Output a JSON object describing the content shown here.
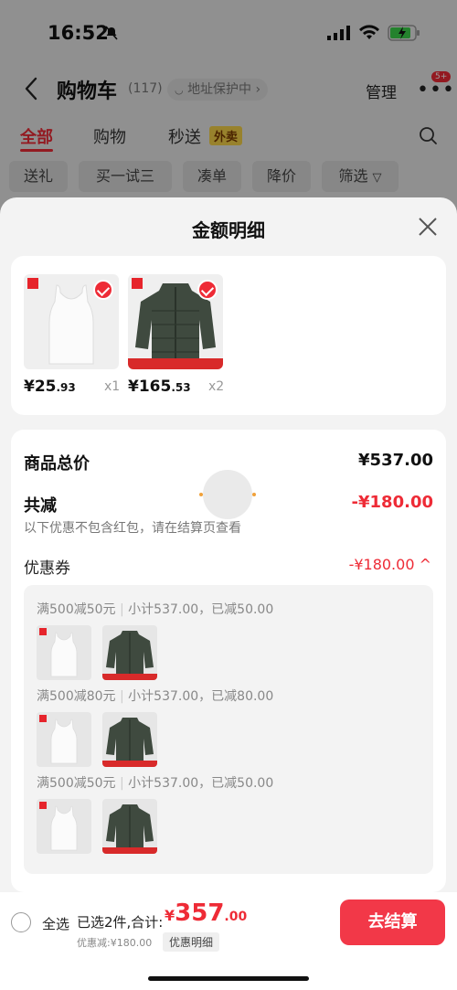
{
  "status_bar": {
    "time": "16:52"
  },
  "header": {
    "title": "购物车",
    "count": "(117)",
    "address_badge": "地址保护中",
    "manage": "管理",
    "more_badge": "5+"
  },
  "tabs": [
    {
      "label": "全部"
    },
    {
      "label": "购物"
    },
    {
      "label": "秒送"
    }
  ],
  "tab_tag": "外卖",
  "filters": [
    "送礼",
    "买一试三",
    "凑单",
    "降价",
    "筛选"
  ],
  "sheet": {
    "title": "金额明细",
    "products": [
      {
        "price_int": "¥25",
        "price_dec": ".93",
        "qty": "x1",
        "kind": "tank-top"
      },
      {
        "price_int": "¥165",
        "price_dec": ".53",
        "qty": "x2",
        "kind": "down-jacket"
      }
    ],
    "total_label": "商品总价",
    "total_value": "¥537.00",
    "discount_label": "共减",
    "discount_value": "-¥180.00",
    "discount_note": "以下优惠不包含红包，请在结算页查看",
    "coupon_label": "优惠券",
    "coupon_value": "-¥180.00 ^",
    "groups": [
      {
        "rule": "满500减50元",
        "summary": "小计537.00，已减50.00"
      },
      {
        "rule": "满500减80元",
        "summary": "小计537.00，已减80.00"
      },
      {
        "rule": "满500减50元",
        "summary": "小计537.00，已减50.00"
      }
    ]
  },
  "bottom_bar": {
    "select_all": "全选",
    "selected": "已选2件,合计:",
    "currency": "¥",
    "amount_int": "357",
    "amount_dec": ".00",
    "discount_text": "优惠减:¥180.00",
    "detail_button": "优惠明细",
    "checkout": "去结算"
  },
  "colors": {
    "accent": "#ee2b36",
    "checkout": "#f23848",
    "sheet_bg": "#f3f3f3"
  }
}
